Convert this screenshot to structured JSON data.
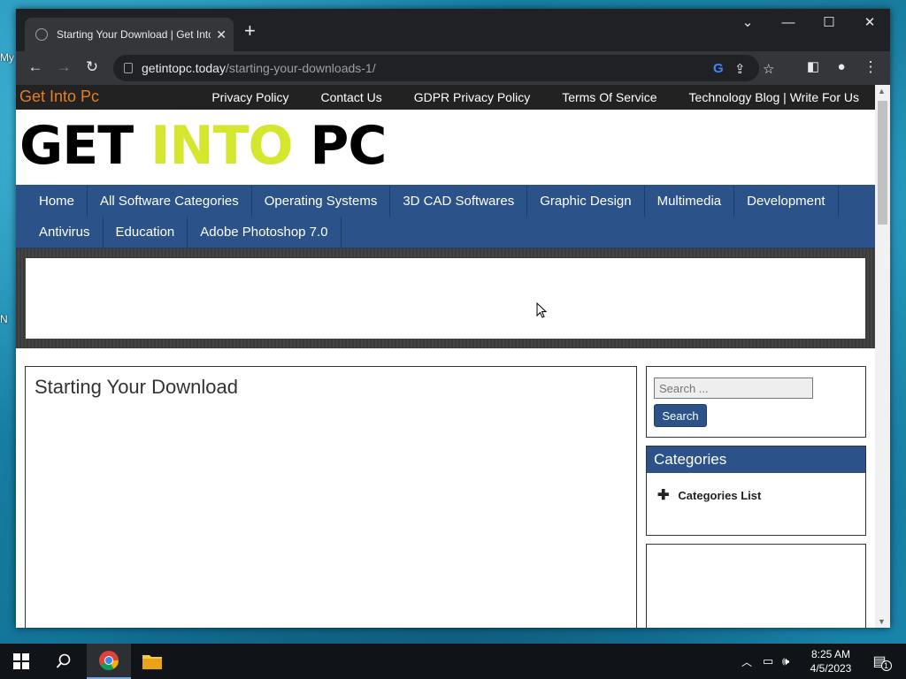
{
  "desktop": {
    "icon_labels": [
      "My",
      "N"
    ]
  },
  "browser": {
    "tab_title": "Starting Your Download | Get Into Pc",
    "url_host": "getintopc.today",
    "url_path": "/starting-your-downloads-1/"
  },
  "site": {
    "brand": "Get Into Pc",
    "top_links": [
      "Privacy Policy",
      "Contact Us",
      "GDPR Privacy Policy",
      "Terms Of Service",
      "Technology Blog | Write For Us"
    ],
    "logo": {
      "part1": "GET ",
      "part2": "INTO",
      "part3": " PC",
      "accent_color": "#d4e62d"
    },
    "main_nav": [
      "Home",
      "All Software Categories",
      "Operating Systems",
      "3D CAD Softwares",
      "Graphic Design",
      "Multimedia",
      "Development",
      "Antivirus",
      "Education",
      "Adobe Photoshop 7.0"
    ],
    "page_title": "Starting Your Download",
    "search": {
      "placeholder": "Search ...",
      "button": "Search"
    },
    "categories_widget": {
      "title": "Categories",
      "item": "Categories List"
    },
    "nav_color": "#2b5289",
    "brand_color": "#e67e22"
  },
  "taskbar": {
    "time": "8:25 AM",
    "date": "4/5/2023",
    "notification_count": "1"
  }
}
